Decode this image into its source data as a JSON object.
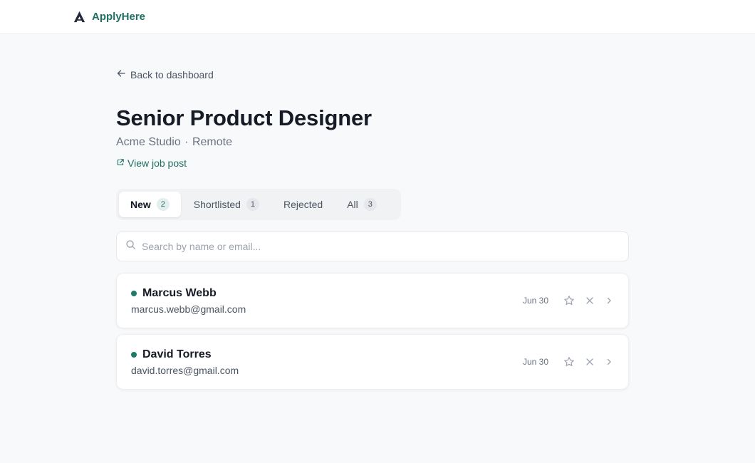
{
  "brand": {
    "name": "ApplyHere",
    "logo_icon": "apply-here-logo-icon"
  },
  "nav": {
    "back_label": "Back to dashboard"
  },
  "job": {
    "title": "Senior Product Designer",
    "company": "Acme Studio",
    "separator": "·",
    "location": "Remote",
    "view_post_label": "View job post"
  },
  "tabs": [
    {
      "label": "New",
      "count": "2",
      "active": true
    },
    {
      "label": "Shortlisted",
      "count": "1",
      "active": false
    },
    {
      "label": "Rejected",
      "count": "",
      "active": false
    },
    {
      "label": "All",
      "count": "3",
      "active": false
    }
  ],
  "search": {
    "placeholder": "Search by name or email...",
    "value": ""
  },
  "candidates": [
    {
      "name": "Marcus Webb",
      "email": "marcus.webb@gmail.com",
      "date": "Jun 30",
      "unread": true
    },
    {
      "name": "David Torres",
      "email": "david.torres@gmail.com",
      "date": "Jun 30",
      "unread": true
    }
  ],
  "colors": {
    "accent": "#1f6f62",
    "background": "#f8f9fa",
    "card": "#ffffff",
    "unread_dot": "#1f7a6a"
  }
}
